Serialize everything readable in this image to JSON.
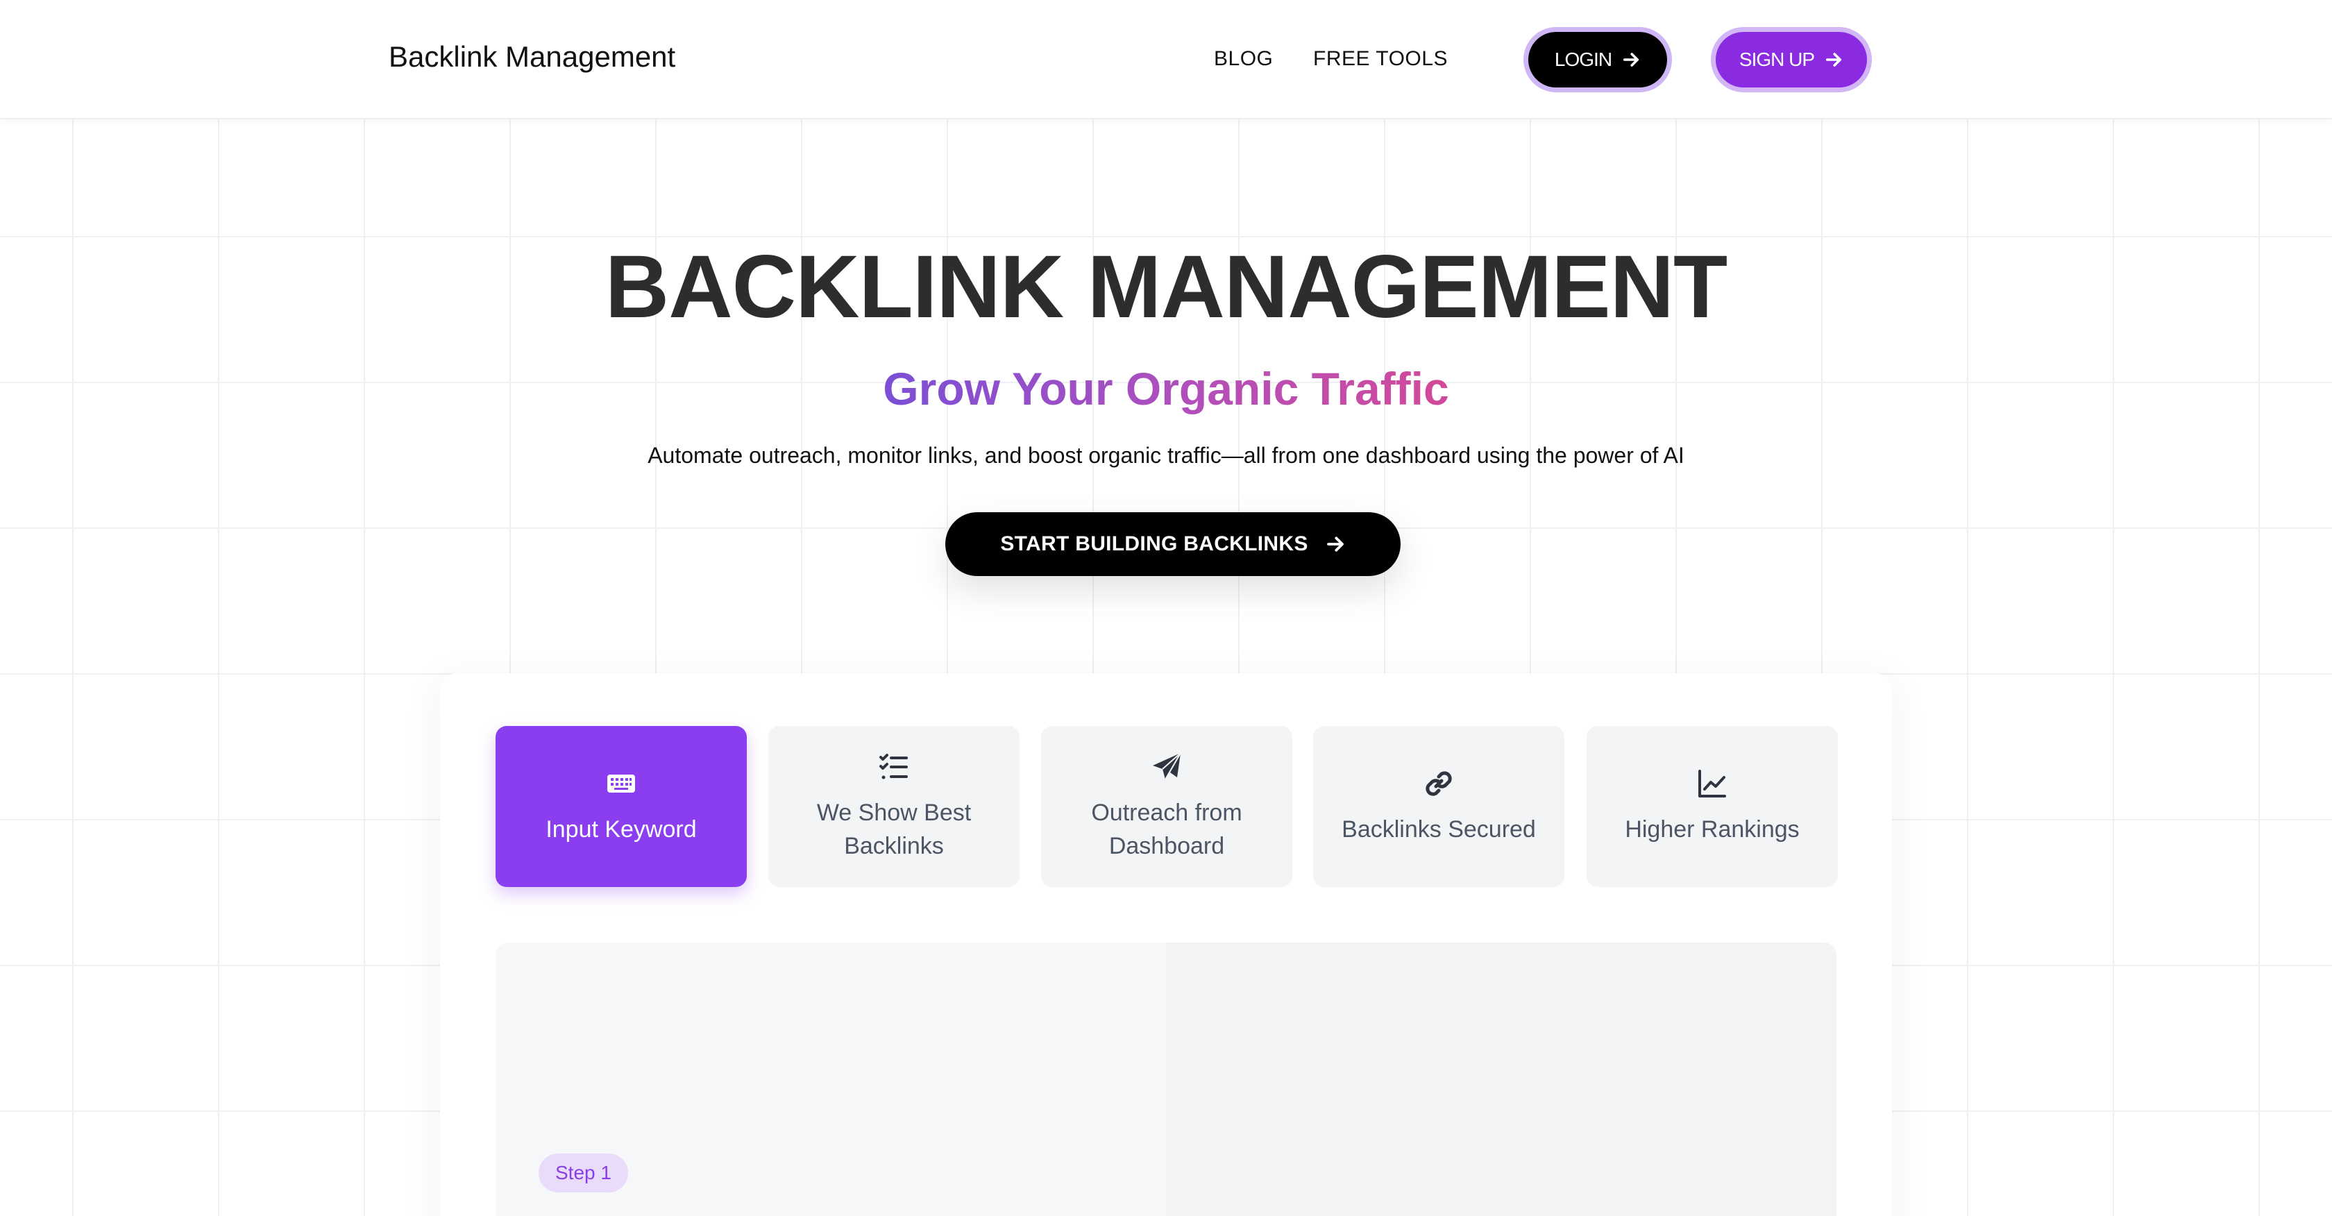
{
  "nav": {
    "brand": "Backlink Management",
    "links": [
      "BLOG",
      "FREE TOOLS"
    ],
    "login_label": "LOGIN",
    "signup_label": "SIGN UP"
  },
  "hero": {
    "title": "BACKLINK MANAGEMENT",
    "subtitle": "Grow Your Organic Traffic",
    "description": "Automate outreach, monitor links, and boost organic traffic—all from one dashboard using the power of AI",
    "cta_label": "START BUILDING BACKLINKS"
  },
  "steps": {
    "items": [
      {
        "label": "Input Keyword",
        "icon": "keyboard-icon",
        "active": true
      },
      {
        "label": "We Show Best Backlinks",
        "icon": "list-check-icon",
        "active": false
      },
      {
        "label": "Outreach from Dashboard",
        "icon": "paper-plane-icon",
        "active": false
      },
      {
        "label": "Backlinks Secured",
        "icon": "link-icon",
        "active": false
      },
      {
        "label": "Higher Rankings",
        "icon": "chart-line-icon",
        "active": false
      }
    ]
  },
  "preview": {
    "badge": "Step 1"
  },
  "colors": {
    "accent": "#8b3ef0",
    "accent_ring": "#cfb6f5",
    "heading": "#2d2d2d",
    "gradient_start": "#7b4fd6",
    "gradient_end": "#d24a9a"
  }
}
